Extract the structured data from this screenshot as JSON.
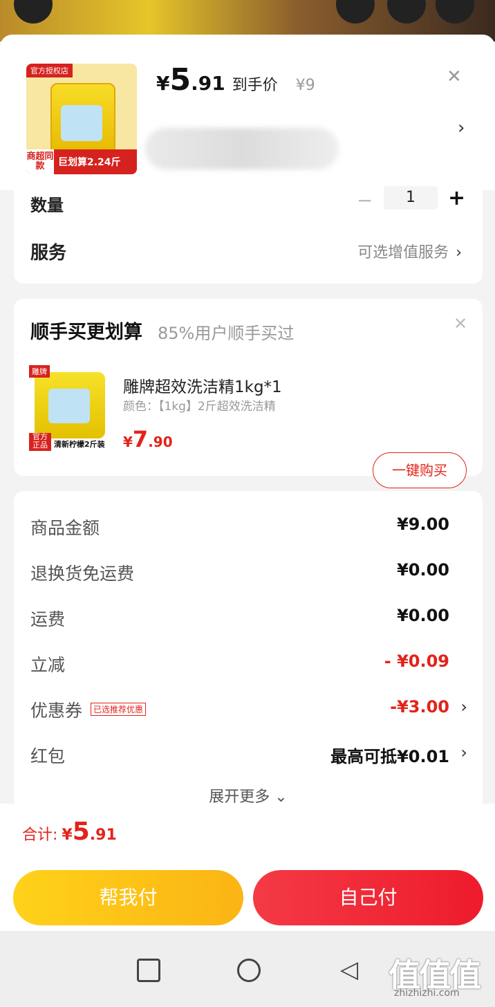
{
  "header": {
    "thumb_tag": "官方授权店",
    "thumb_band_left": "商超同款",
    "thumb_band_right": "巨划算2.24斤",
    "price_symbol": "¥",
    "price_int": "5",
    "price_dec": ".91",
    "price_label": "到手价",
    "original_price": "¥9"
  },
  "quantity": {
    "label": "数量",
    "value": "1"
  },
  "service": {
    "label": "服务",
    "value": "可选增值服务"
  },
  "addon": {
    "title": "顺手买更划算",
    "subtitle": "85%用户顺手买过",
    "product_name": "雕牌超效洗洁精1kg*1",
    "product_color": "颜色：【1kg】2斤超效洗洁精",
    "price_symbol": "¥",
    "price_int": "7",
    "price_dec": ".90",
    "thumb_tag": "雕牌",
    "thumb_badge": "官方正品",
    "thumb_bottom": "清新柠檬2斤装",
    "buy_label": "一键购买"
  },
  "summary": {
    "rows": [
      {
        "label": "商品金额",
        "value": "¥9.00"
      },
      {
        "label": "退换货免运费",
        "value": "¥0.00"
      },
      {
        "label": "运费",
        "value": "¥0.00"
      },
      {
        "label": "立减",
        "value": "- ¥0.09"
      },
      {
        "label": "优惠券",
        "tag": "已选推荐优惠",
        "value": "-¥3.00"
      },
      {
        "label": "红包",
        "value": "最高可抵¥0.01"
      }
    ],
    "expand_label": "展开更多"
  },
  "total": {
    "label": "合计:",
    "symbol": "¥",
    "int": "5",
    "dec": ".91"
  },
  "actions": {
    "help_pay": "帮我付",
    "self_pay": "自己付"
  },
  "watermark": {
    "main": "值值值",
    "sub": "zhizhizhi.com"
  },
  "colors": {
    "accent_red": "#e2231a",
    "help_yellow": "#fbc117",
    "self_red": "#f02a38"
  }
}
